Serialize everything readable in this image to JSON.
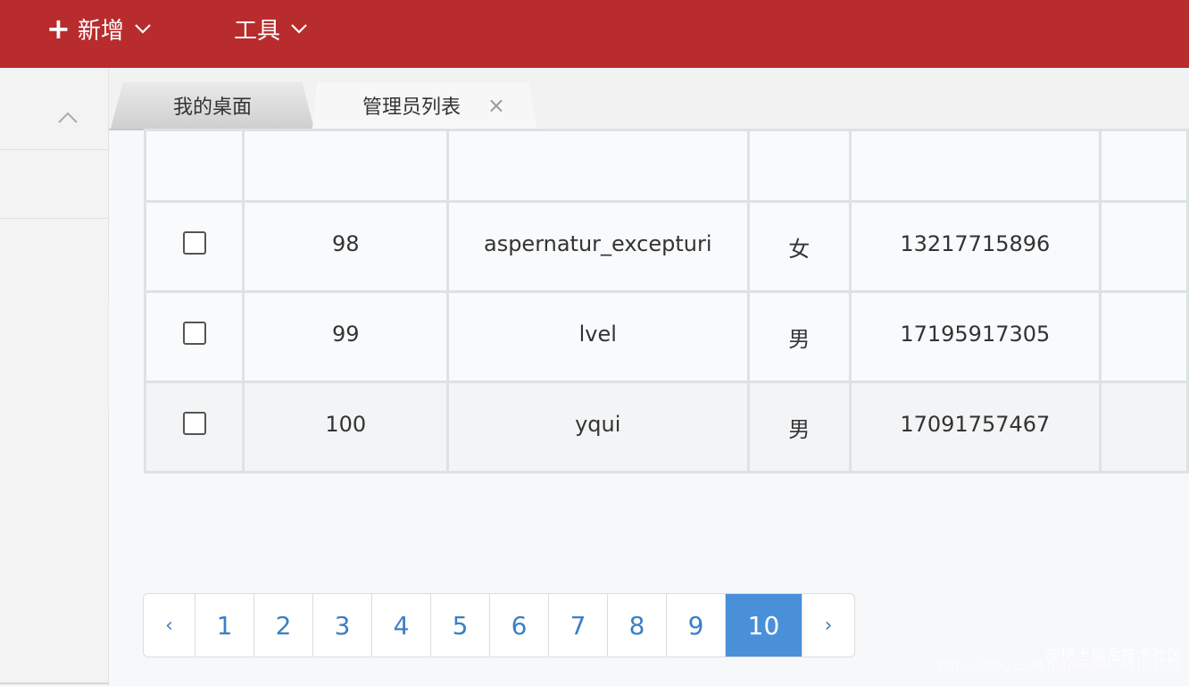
{
  "topbar": {
    "add_label": "新增",
    "tools_label": "工具"
  },
  "tabs": [
    {
      "label": "我的桌面"
    },
    {
      "label": "管理员列表",
      "close": "×"
    }
  ],
  "table": {
    "rows": [
      {
        "id": "98",
        "username": "aspernatur_excepturi",
        "gender": "女",
        "phone": "13217715896"
      },
      {
        "id": "99",
        "username": "lvel",
        "gender": "男",
        "phone": "17195917305"
      },
      {
        "id": "100",
        "username": "yqui",
        "gender": "男",
        "phone": "17091757467"
      }
    ]
  },
  "pagination": {
    "prev": "‹",
    "next": "›",
    "pages": [
      "1",
      "2",
      "3",
      "4",
      "5",
      "6",
      "7",
      "8",
      "9",
      "10"
    ],
    "current": "10"
  },
  "watermark": {
    "line1": "@稀土掘金技术社区",
    "line2": "https://blog.csdn.net/weixin_44103733"
  }
}
